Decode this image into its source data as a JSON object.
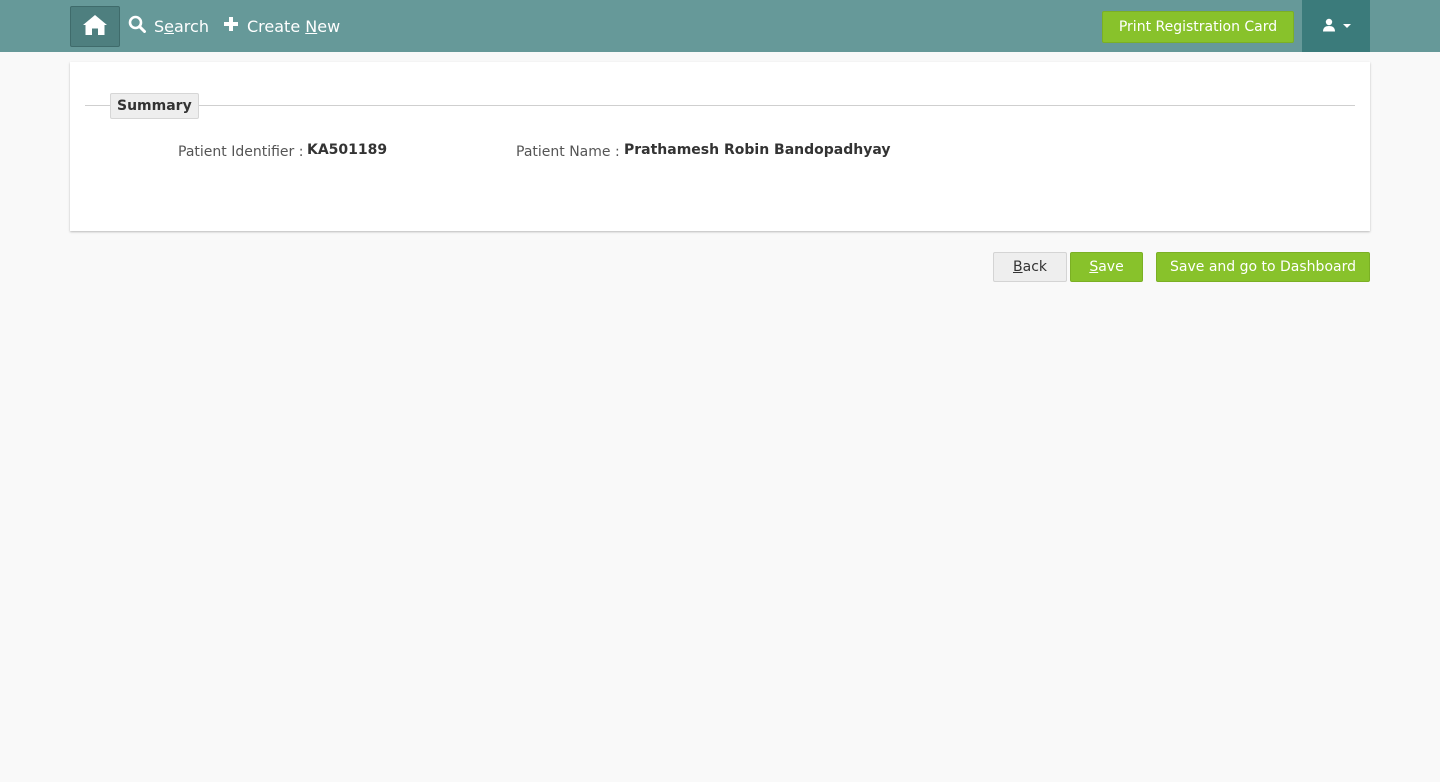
{
  "nav": {
    "search": {
      "first": "S",
      "underlined": "e",
      "rest": "arch"
    },
    "create_new": {
      "prefix": "Create ",
      "underlined": "N",
      "rest": "ew"
    },
    "print_registration_card": "Print Registration Card"
  },
  "summary": {
    "legend": "Summary",
    "patient_identifier_label": "Patient Identifier :",
    "patient_identifier_value": "KA501189",
    "patient_name_label": "Patient Name :",
    "patient_name_value": "Prathamesh Robin Bandopadhyay"
  },
  "actions": {
    "back": {
      "underlined": "B",
      "rest": "ack"
    },
    "save": {
      "underlined": "S",
      "rest": "ave"
    },
    "save_dashboard": "Save and go to Dashboard"
  },
  "colors": {
    "topbar": "#669999",
    "accent_green": "#88c22b",
    "user_menu": "#3b7b7b",
    "background": "#f9f9f9"
  },
  "icons": [
    "home-icon",
    "search-icon",
    "plus-icon",
    "user-icon",
    "chevron-down-icon"
  ]
}
